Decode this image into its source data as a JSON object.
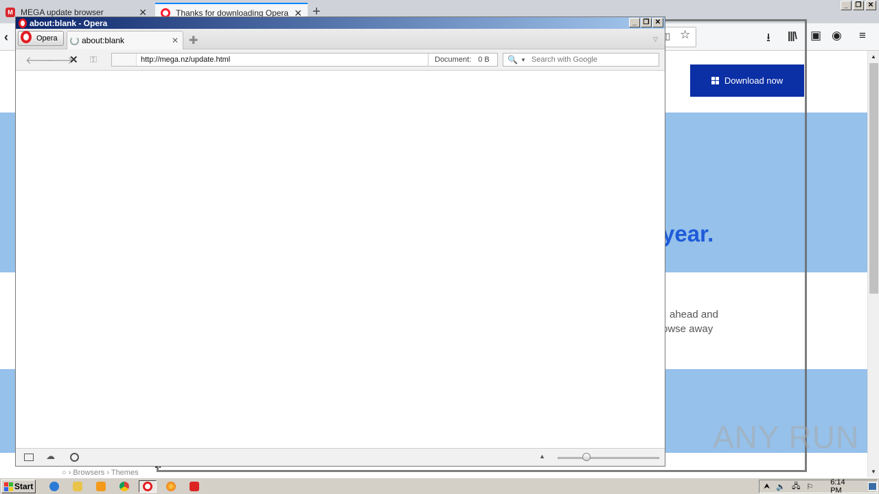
{
  "firefox": {
    "tabs": [
      {
        "label": "MEGA update browser",
        "icon": "mega-icon",
        "favicon_letter": "M"
      },
      {
        "label": "Thanks for downloading Opera",
        "icon": "opera-icon"
      }
    ],
    "new_tab_glyph": "+",
    "page": {
      "download_button": "Download now",
      "hero_fragment": "year.",
      "body_line1": "ahead and",
      "body_line2": "owse away",
      "footer_crumb1": "Browsers",
      "footer_crumb2": "Themes"
    },
    "accent_color": "#0b2fa5",
    "band_color": "#95c1ea"
  },
  "opera": {
    "window_title": "about:blank - Opera",
    "menu_label": "Opera",
    "tab_label": "about:blank",
    "url": "http://mega.nz/update.html",
    "document_label": "Document:",
    "document_size": "0 B",
    "search_placeholder": "Search with Google",
    "brand_color": "#e31c23"
  },
  "watermark": "ANY RUN",
  "taskbar": {
    "start_label": "Start",
    "clock": "6:14 PM",
    "apps": [
      "internet-explorer",
      "file-explorer",
      "media-player",
      "chrome",
      "opera",
      "firefox",
      "app"
    ]
  }
}
